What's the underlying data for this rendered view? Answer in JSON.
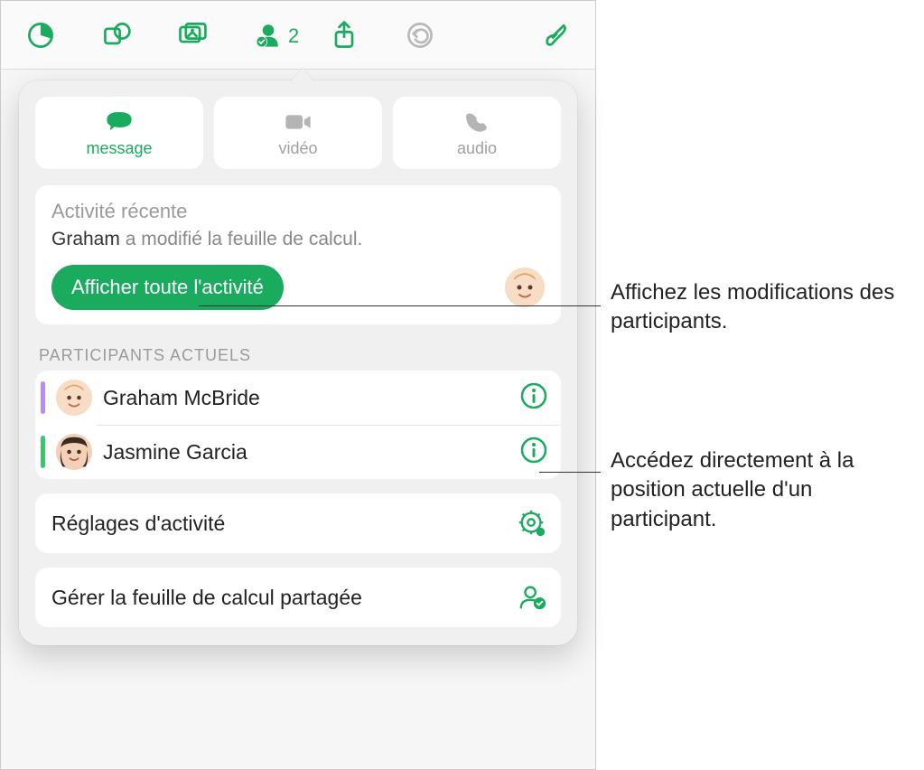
{
  "toolbar": {
    "collab_count": "2"
  },
  "comm": {
    "message": "message",
    "video": "vidéo",
    "audio": "audio"
  },
  "activity": {
    "title": "Activité récente",
    "actor": "Graham",
    "action": " a modifié la feuille de calcul.",
    "show_all": "Afficher toute l'activité"
  },
  "participants": {
    "header": "PARTICIPANTS ACTUELS",
    "items": [
      {
        "name": "Graham McBride",
        "presence_color": "#b88cf5"
      },
      {
        "name": "Jasmine Garcia",
        "presence_color": "#3ac76b"
      }
    ]
  },
  "settings": {
    "activity_settings": "Réglages d'activité",
    "manage_shared": "Gérer la feuille de calcul partagée"
  },
  "callouts": {
    "c1": "Affichez les modifications des participants.",
    "c2": "Accédez directement à la position actuelle d'un participant."
  }
}
